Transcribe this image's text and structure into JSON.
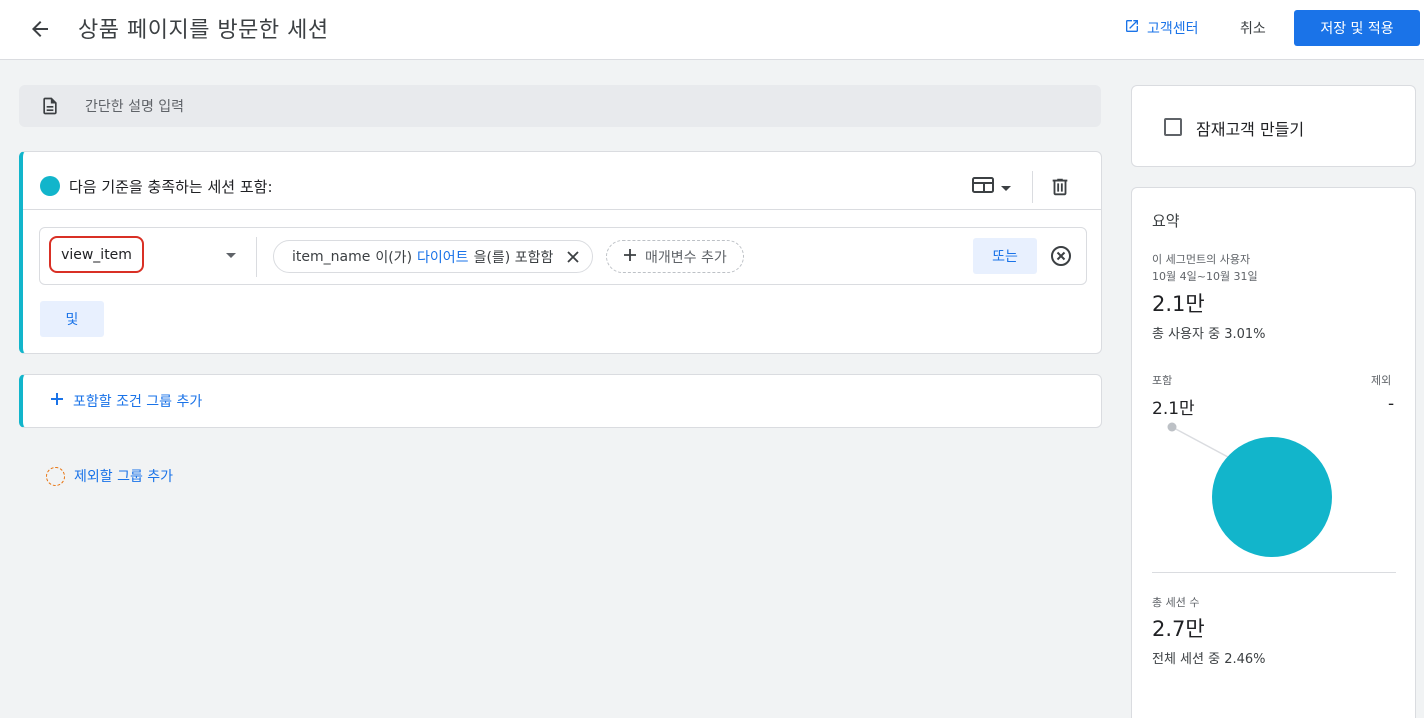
{
  "header": {
    "title": "상품 페이지를 방문한 세션",
    "help_label": "고객센터",
    "cancel_label": "취소",
    "save_label": "저장 및 적용"
  },
  "description": {
    "placeholder": "간단한 설명 입력"
  },
  "include_group": {
    "heading": "다음 기준을 충족하는 세션 포함:",
    "condition": {
      "event": "view_item",
      "filter": {
        "param": "item_name",
        "op1": "이(가)",
        "value": "다이어트",
        "op2": "을(를) 포함함"
      },
      "add_param_label": "매개변수 추가",
      "or_label": "또는"
    },
    "and_label": "및"
  },
  "add_include_group_label": "포함할 조건 그룹 추가",
  "add_exclude_group_label": "제외할 그룹 추가",
  "audience": {
    "checkbox_label": "잠재고객 만들기"
  },
  "summary": {
    "title": "요약",
    "users_label": "이 세그먼트의 사용자",
    "date_range": "10월 4일~10월 31일",
    "users_value": "2.1만",
    "users_share": "총 사용자 중 3.01%",
    "include_label": "포함",
    "exclude_label": "제외",
    "include_value": "2.1만",
    "exclude_value": "-",
    "sessions_label": "총 세션 수",
    "sessions_value": "2.7만",
    "sessions_share": "전체 세션 중 2.46%",
    "pie_color": "#12b5cb"
  },
  "colors": {
    "accent": "#1a73e8",
    "include": "#12b5cb",
    "alert": "#d93025",
    "exclude": "#e8710a"
  },
  "icons": [
    "back-arrow-icon",
    "open-in-new-icon",
    "document-icon",
    "layout-icon",
    "chevron-down-icon",
    "trash-icon",
    "close-icon",
    "plus-icon",
    "remove-circle-icon",
    "dashed-circle-icon"
  ]
}
